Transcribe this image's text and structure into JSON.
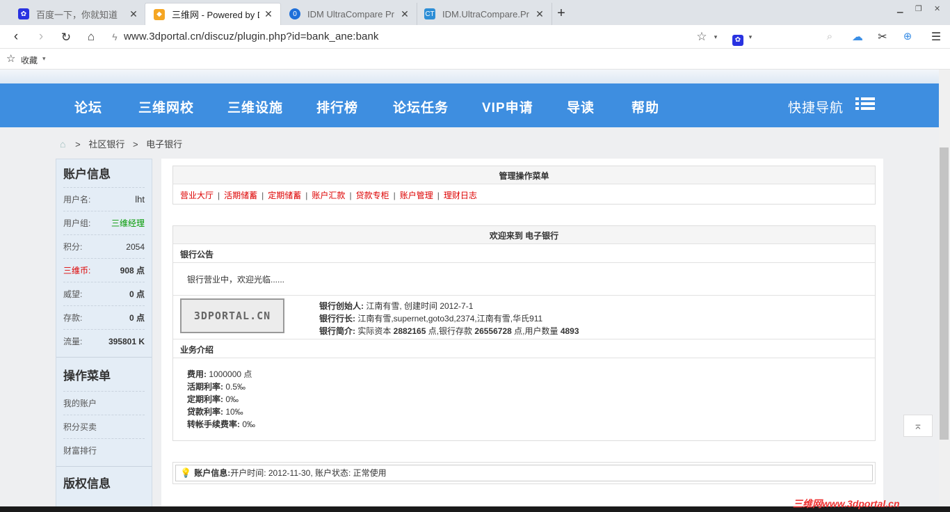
{
  "browser": {
    "tabs": [
      {
        "title": "百度一下，你就知道",
        "icon": "baidu-paw-icon",
        "icon_color": "#2932e1"
      },
      {
        "title": "三维网 - Powered by D",
        "icon": "3dportal-logo-icon",
        "icon_color": "#f5a623"
      },
      {
        "title": "IDM UltraCompare Pr",
        "icon": "idm-logo-icon",
        "icon_color": "#1e6fd9"
      },
      {
        "title": "IDM.UltraCompare.Pr",
        "icon": "ct-logo-icon",
        "icon_color": "#2d8ed6"
      }
    ],
    "url": "www.3dportal.cn/discuz/plugin.php?id=bank_ane:bank",
    "bookmarks_label": "收藏"
  },
  "site": {
    "nav": [
      "论坛",
      "三维网校",
      "三维设施",
      "排行榜",
      "论坛任务",
      "VIP申请",
      "导读",
      "帮助"
    ],
    "quick_nav": "快捷导航",
    "nav_color": "#3e8ee0"
  },
  "breadcrumb": {
    "sep1": ">",
    "item1": "社区银行",
    "sep2": ">",
    "item2": "电子银行"
  },
  "sidebar": {
    "account_title": "账户信息",
    "rows": [
      {
        "label": "用户名:",
        "value": "lht"
      },
      {
        "label": "用户组:",
        "value": "三维经理"
      },
      {
        "label": "积分:",
        "value": "2054"
      },
      {
        "label": "三维币:",
        "value": "908 点"
      },
      {
        "label": "威望:",
        "value": "0 点"
      },
      {
        "label": "存款:",
        "value": "0 点"
      },
      {
        "label": "流量:",
        "value": "395801 K"
      }
    ],
    "menu_title": "操作菜单",
    "menu": [
      "我的账户",
      "积分买卖",
      "财富排行"
    ],
    "copyright_title": "版权信息"
  },
  "admin_menu": {
    "title": "管理操作菜单",
    "links": [
      "营业大厅",
      "活期储蓄",
      "定期储蓄",
      "账户汇款",
      "贷款专柜",
      "账户管理",
      "理财日志"
    ],
    "sep": "|"
  },
  "welcome": {
    "title": "欢迎来到 电子银行",
    "notice_title": "银行公告",
    "notice_text": "银行营业中，欢迎光临......",
    "logo_text": "3DPORTAL.CN",
    "founder_label": "银行创始人:",
    "founder_value": " 江南有雪, 创建时间 2012-7-1",
    "president_label": "银行行长:",
    "president_value": " 江南有雪,supernet,goto3d,2374,江南有雪,华氏911",
    "intro_label": "银行简介:",
    "intro_pre": " 实际资本 ",
    "capital": "2882165",
    "intro_mid1": " 点,银行存款 ",
    "deposits": "26556728",
    "intro_mid2": " 点,用户数量 ",
    "users": "4893",
    "business_title": "业务介绍",
    "business": [
      {
        "label": "费用:",
        "value": " 1000000 点"
      },
      {
        "label": "活期利率:",
        "value": " 0.5‰"
      },
      {
        "label": "定期利率:",
        "value": " 0‰"
      },
      {
        "label": "贷款利率:",
        "value": " 10‰"
      },
      {
        "label": "转帐手续费率:",
        "value": " 0‰"
      }
    ]
  },
  "account_status": {
    "label": "账户信息:",
    "text": " 开户时间: 2012-11-30, 账户状态: 正常使用"
  },
  "watermark": "三维网www.3dportal.cn"
}
